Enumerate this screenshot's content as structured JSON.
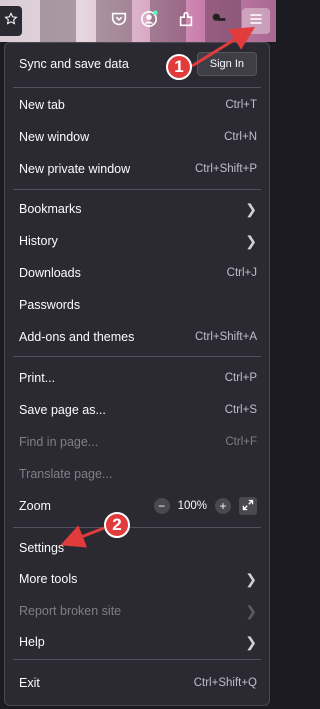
{
  "panel": {
    "sync_label": "Sync and save data",
    "sign_in": "Sign In",
    "items": {
      "new_tab": {
        "label": "New tab",
        "shortcut": "Ctrl+T"
      },
      "new_window": {
        "label": "New window",
        "shortcut": "Ctrl+N"
      },
      "new_private": {
        "label": "New private window",
        "shortcut": "Ctrl+Shift+P"
      },
      "bookmarks": {
        "label": "Bookmarks"
      },
      "history": {
        "label": "History"
      },
      "downloads": {
        "label": "Downloads",
        "shortcut": "Ctrl+J"
      },
      "passwords": {
        "label": "Passwords"
      },
      "addons": {
        "label": "Add-ons and themes",
        "shortcut": "Ctrl+Shift+A"
      },
      "print": {
        "label": "Print...",
        "shortcut": "Ctrl+P"
      },
      "save_page": {
        "label": "Save page as...",
        "shortcut": "Ctrl+S"
      },
      "find": {
        "label": "Find in page...",
        "shortcut": "Ctrl+F"
      },
      "translate": {
        "label": "Translate page..."
      },
      "zoom": {
        "label": "Zoom",
        "minus": "−",
        "value": "100%",
        "plus": "+"
      },
      "settings": {
        "label": "Settings"
      },
      "more_tools": {
        "label": "More tools"
      },
      "report": {
        "label": "Report broken site"
      },
      "help": {
        "label": "Help"
      },
      "exit": {
        "label": "Exit",
        "shortcut": "Ctrl+Shift+Q"
      }
    }
  },
  "annotations": {
    "step1": "1",
    "step2": "2"
  },
  "colors": {
    "panel_bg": "#2b2a33",
    "annotation_red": "#e23b3b",
    "disabled_text": "#7f7f87"
  },
  "icons": [
    "star-icon",
    "pocket-icon",
    "account-icon",
    "extensions-icon",
    "key-icon",
    "hamburger-menu-icon",
    "chevron-right-icon",
    "fullscreen-icon"
  ]
}
